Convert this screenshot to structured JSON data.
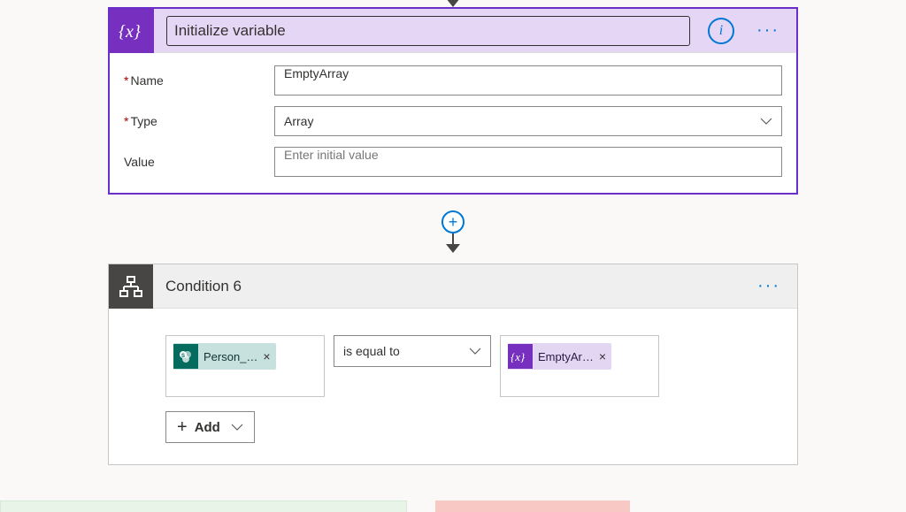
{
  "initVar": {
    "title": "Initialize variable",
    "fields": {
      "nameLabel": "Name",
      "nameValue": "EmptyArray",
      "typeLabel": "Type",
      "typeValue": "Array",
      "valueLabel": "Value",
      "valuePlaceholder": "Enter initial value"
    }
  },
  "condition": {
    "title": "Condition 6",
    "leftToken": "Person_…",
    "operator": "is equal to",
    "rightToken": "EmptyAr…",
    "addLabel": "Add"
  }
}
